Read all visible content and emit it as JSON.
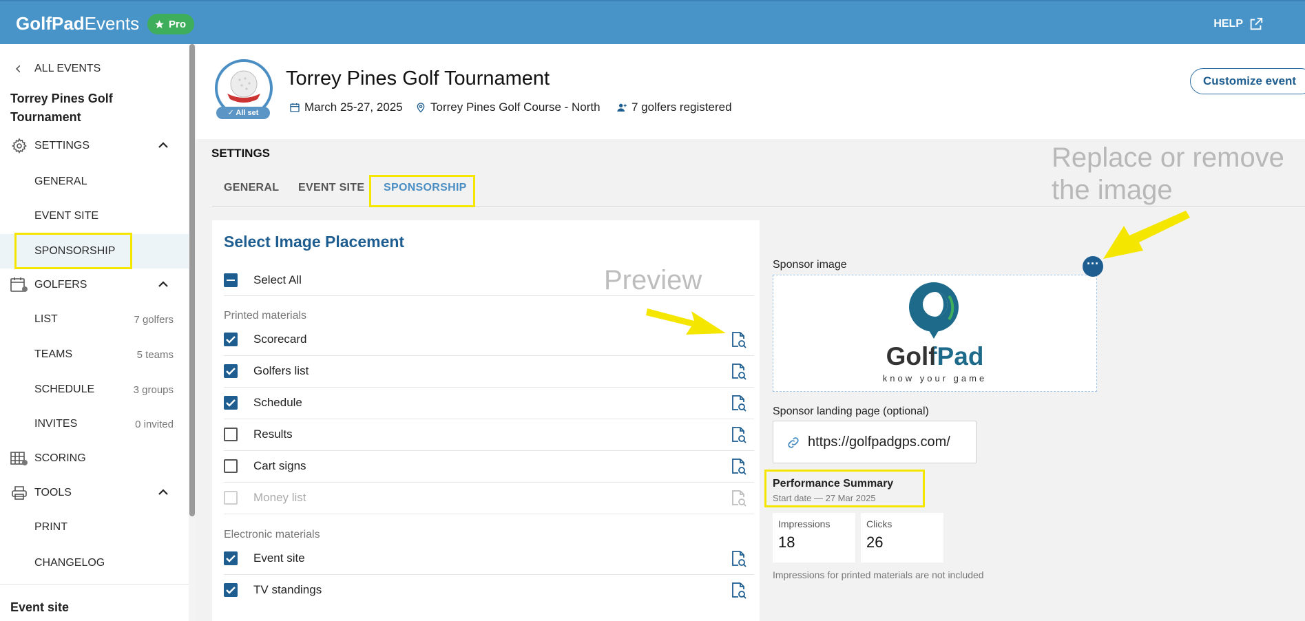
{
  "topbar": {
    "logo_bold": "GolfPad",
    "logo_light": "Events",
    "pro_badge": "Pro",
    "help": "HELP"
  },
  "sidebar": {
    "back": "ALL EVENTS",
    "event_name_line1": "Torrey Pines Golf",
    "event_name_line2": "Tournament",
    "items": [
      {
        "label": "SETTINGS"
      },
      {
        "label": "GENERAL"
      },
      {
        "label": "EVENT SITE"
      },
      {
        "label": "SPONSORSHIP"
      },
      {
        "label": "GOLFERS"
      },
      {
        "label": "LIST",
        "count": "7 golfers"
      },
      {
        "label": "TEAMS",
        "count": "5 teams"
      },
      {
        "label": "SCHEDULE",
        "count": "3 groups"
      },
      {
        "label": "INVITES",
        "count": "0 invited"
      },
      {
        "label": "SCORING"
      },
      {
        "label": "TOOLS"
      },
      {
        "label": "PRINT"
      },
      {
        "label": "CHANGELOG"
      }
    ],
    "footer": "Event site"
  },
  "header": {
    "badge": "All set",
    "title": "Torrey Pines Golf Tournament",
    "date": "March 25-27, 2025",
    "course": "Torrey Pines Golf Course - North",
    "golfers": "7 golfers registered",
    "customize": "Customize event"
  },
  "settings": {
    "label": "SETTINGS",
    "tabs": [
      "GENERAL",
      "EVENT SITE",
      "SPONSORSHIP"
    ]
  },
  "placement": {
    "title": "Select Image Placement",
    "select_all": "Select All",
    "printed_label": "Printed materials",
    "printed": [
      {
        "label": "Scorecard"
      },
      {
        "label": "Golfers list"
      },
      {
        "label": "Schedule"
      },
      {
        "label": "Results"
      },
      {
        "label": "Cart signs"
      },
      {
        "label": "Money list"
      }
    ],
    "electronic_label": "Electronic materials",
    "electronic": [
      {
        "label": "Event site"
      },
      {
        "label": "TV standings"
      }
    ]
  },
  "annotations": {
    "preview": "Preview",
    "replace_line1": "Replace or remove",
    "replace_line2": "the image"
  },
  "sponsor": {
    "image_label": "Sponsor image",
    "logo_word": "GolfPad",
    "logo_tagline": "know your game",
    "landing_label": "Sponsor landing page (optional)",
    "landing_url": "https://golfpadgps.com/",
    "perf_title": "Performance Summary",
    "perf_start": "Start date — 27 Mar 2025",
    "impressions_label": "Impressions",
    "impressions_value": "18",
    "clicks_label": "Clicks",
    "clicks_value": "26",
    "note": "Impressions for printed materials are not included"
  },
  "colors": {
    "topbar": "#4894c8",
    "accent": "#1d5d90",
    "highlight": "#f5e600",
    "pro": "#3fae5c"
  }
}
